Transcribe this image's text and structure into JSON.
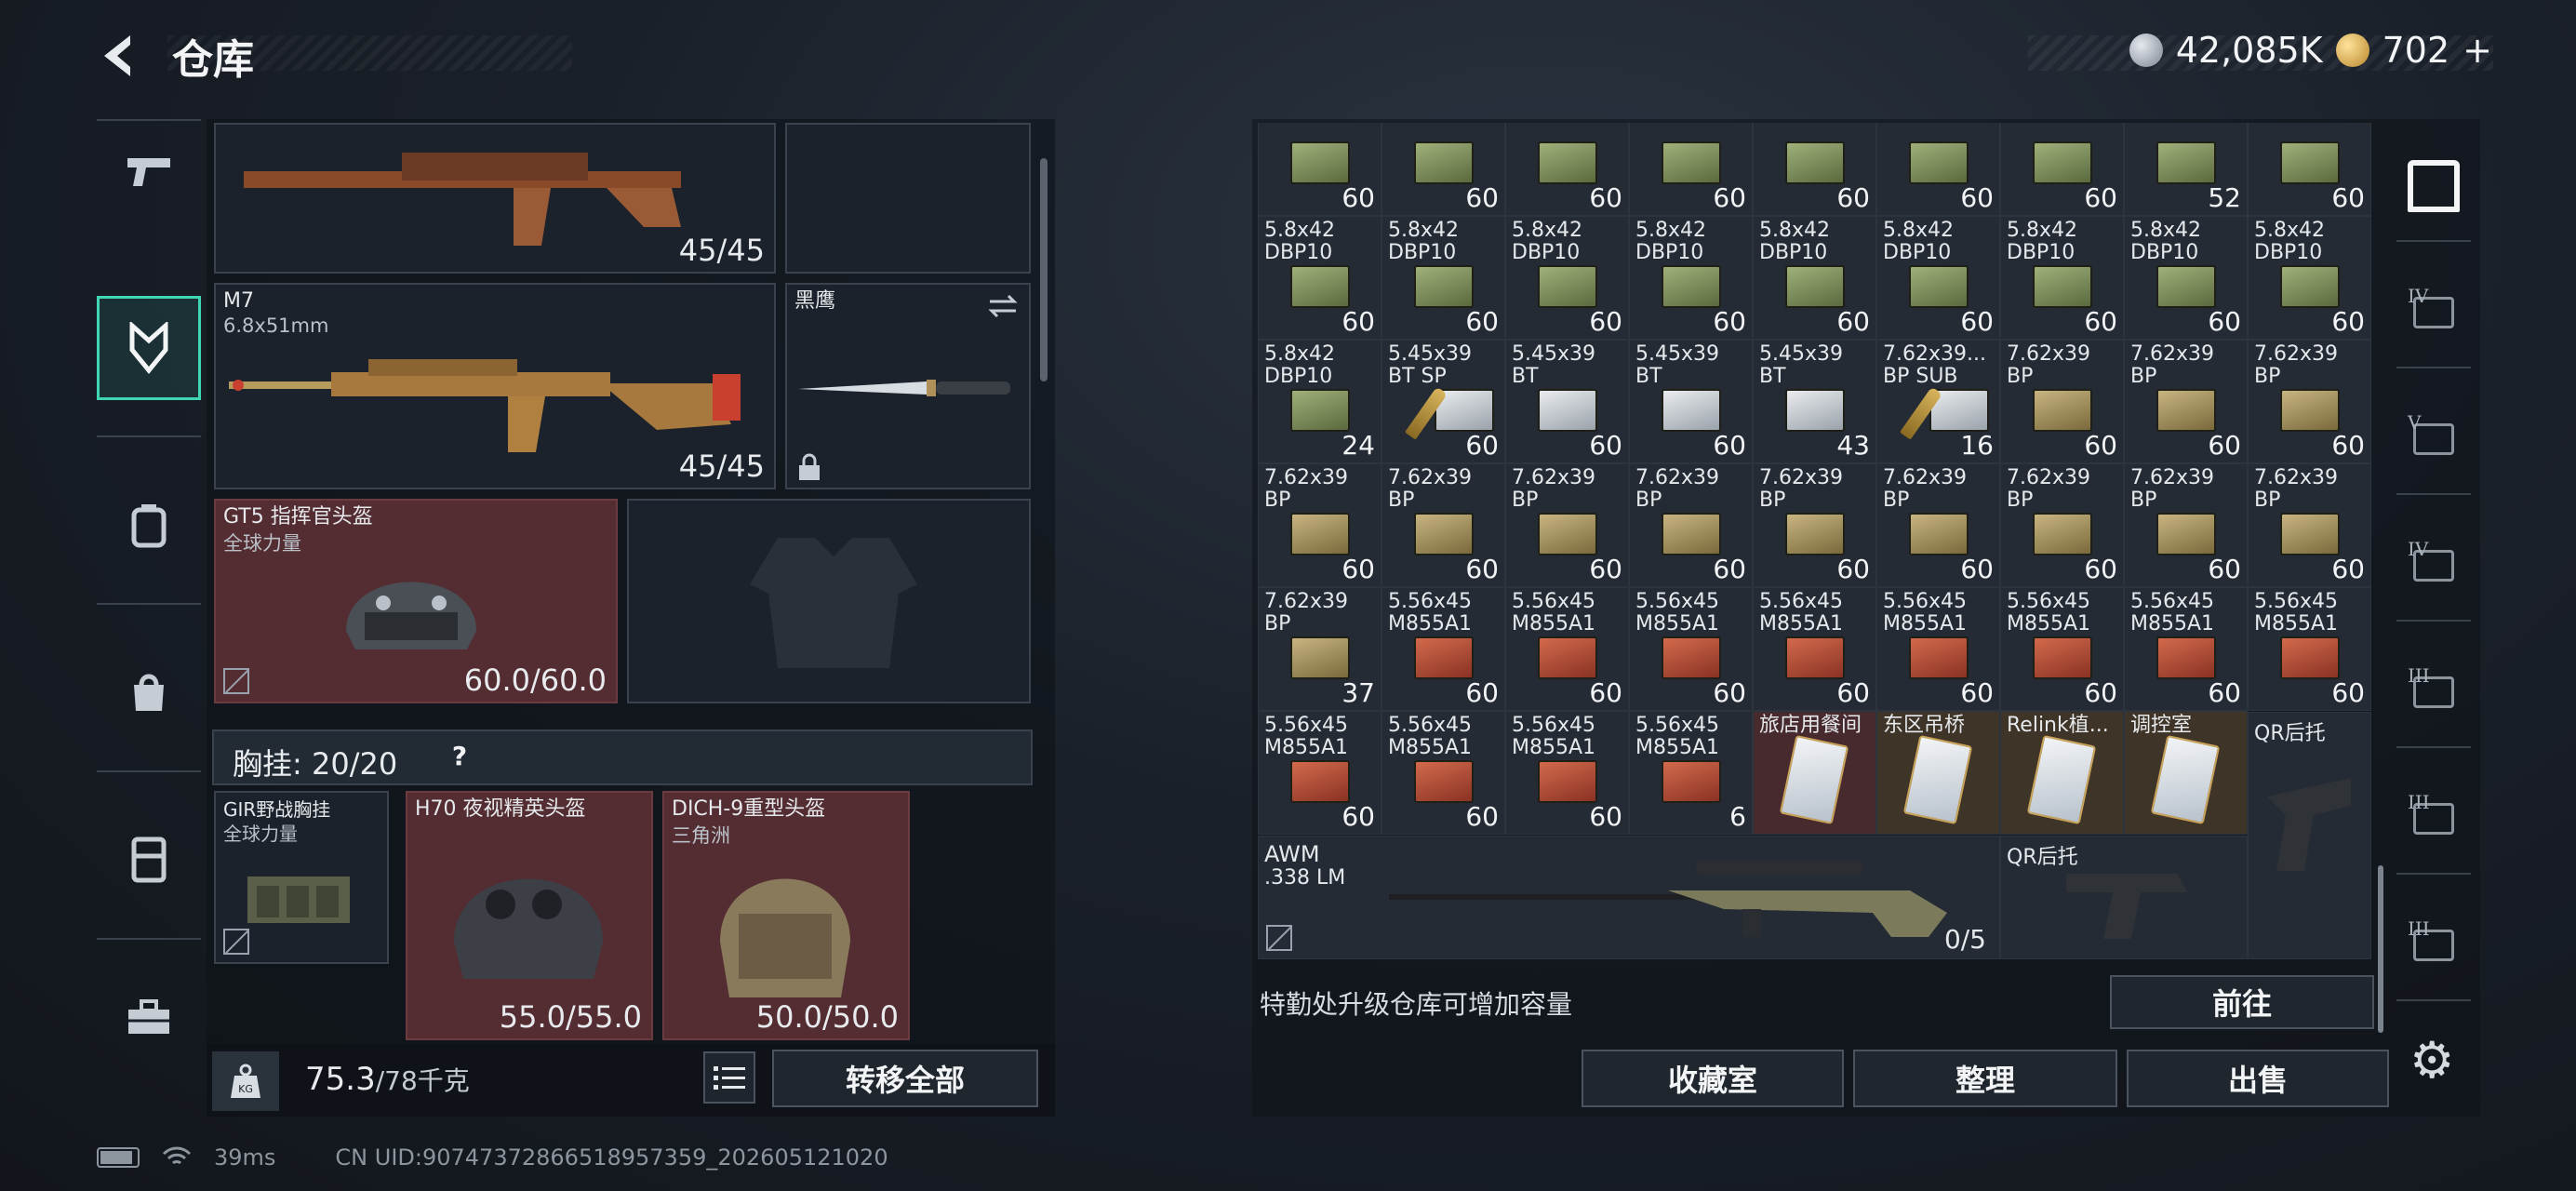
{
  "header": {
    "title": "仓库",
    "currency_silver": "42,085K",
    "currency_gold": "702",
    "add_symbol": "+"
  },
  "sidebar": {
    "items": [
      {
        "icon": "pistol-icon"
      },
      {
        "icon": "armor-emblem-icon",
        "active": true
      },
      {
        "icon": "backpack-icon"
      },
      {
        "icon": "bag-icon"
      },
      {
        "icon": "vest-icon"
      },
      {
        "icon": "toolbox-icon"
      }
    ]
  },
  "loadout": {
    "rifle_top": {
      "durability": "45/45"
    },
    "m7": {
      "name": "M7",
      "caliber": "6.8x51mm",
      "durability": "45/45"
    },
    "knife": {
      "name": "黑鹰"
    },
    "helmet": {
      "name": "GT5 指挥官头盔",
      "sub": "全球力量",
      "durability": "60.0/60.0"
    },
    "chest_label": "胸挂:",
    "chest_value": "20/20",
    "chest_help": "?",
    "rig": {
      "name": "GIR野战胸挂",
      "sub": "全球力量"
    },
    "h70": {
      "name": "H70 夜视精英头盔",
      "durability": "55.0/55.0"
    },
    "dich": {
      "name": "DICH-9重型头盔",
      "sub": "三角洲",
      "durability": "50.0/50.0"
    },
    "weight_value": "75.3",
    "weight_max": "/78千克",
    "kg_label": "KG",
    "list_icon": "list-icon",
    "transfer_all": "转移全部"
  },
  "storage": {
    "row0": [
      {
        "label": "",
        "count": "60",
        "box": "green"
      },
      {
        "label": "",
        "count": "60",
        "box": "green"
      },
      {
        "label": "",
        "count": "60",
        "box": "green"
      },
      {
        "label": "",
        "count": "60",
        "box": "green"
      },
      {
        "label": "",
        "count": "60",
        "box": "green"
      },
      {
        "label": "",
        "count": "60",
        "box": "green"
      },
      {
        "label": "",
        "count": "60",
        "box": "green"
      },
      {
        "label": "",
        "count": "52",
        "box": "green"
      },
      {
        "label": "",
        "count": "60",
        "box": "green"
      }
    ],
    "row1": [
      {
        "label": "5.8x42\nDBP10",
        "count": "60",
        "box": "green"
      },
      {
        "label": "5.8x42\nDBP10",
        "count": "60",
        "box": "green"
      },
      {
        "label": "5.8x42\nDBP10",
        "count": "60",
        "box": "green"
      },
      {
        "label": "5.8x42\nDBP10",
        "count": "60",
        "box": "green"
      },
      {
        "label": "5.8x42\nDBP10",
        "count": "60",
        "box": "green"
      },
      {
        "label": "5.8x42\nDBP10",
        "count": "60",
        "box": "green"
      },
      {
        "label": "5.8x42\nDBP10",
        "count": "60",
        "box": "green"
      },
      {
        "label": "5.8x42\nDBP10",
        "count": "60",
        "box": "green"
      },
      {
        "label": "5.8x42\nDBP10",
        "count": "60",
        "box": "green"
      }
    ],
    "row2": [
      {
        "label": "5.8x42\nDBP10",
        "count": "24",
        "box": "green"
      },
      {
        "label": "5.45x39\nBT SP",
        "count": "60",
        "box": "bullet"
      },
      {
        "label": "5.45x39\nBT",
        "count": "60",
        "box": "white"
      },
      {
        "label": "5.45x39\nBT",
        "count": "60",
        "box": "white"
      },
      {
        "label": "5.45x39\nBT",
        "count": "43",
        "box": "white"
      },
      {
        "label": "7.62x39...\nBP SUB",
        "count": "16",
        "box": "bullet"
      },
      {
        "label": "7.62x39\nBP",
        "count": "60",
        "box": "olive"
      },
      {
        "label": "7.62x39\nBP",
        "count": "60",
        "box": "olive"
      },
      {
        "label": "7.62x39\nBP",
        "count": "60",
        "box": "olive"
      }
    ],
    "row3": [
      {
        "label": "7.62x39\nBP",
        "count": "60",
        "box": "olive"
      },
      {
        "label": "7.62x39\nBP",
        "count": "60",
        "box": "olive"
      },
      {
        "label": "7.62x39\nBP",
        "count": "60",
        "box": "olive"
      },
      {
        "label": "7.62x39\nBP",
        "count": "60",
        "box": "olive"
      },
      {
        "label": "7.62x39\nBP",
        "count": "60",
        "box": "olive"
      },
      {
        "label": "7.62x39\nBP",
        "count": "60",
        "box": "olive"
      },
      {
        "label": "7.62x39\nBP",
        "count": "60",
        "box": "olive"
      },
      {
        "label": "7.62x39\nBP",
        "count": "60",
        "box": "olive"
      },
      {
        "label": "7.62x39\nBP",
        "count": "60",
        "box": "olive"
      }
    ],
    "row4": [
      {
        "label": "7.62x39\nBP",
        "count": "37",
        "box": "olive"
      },
      {
        "label": "5.56x45\nM855A1",
        "count": "60",
        "box": "red"
      },
      {
        "label": "5.56x45\nM855A1",
        "count": "60",
        "box": "red"
      },
      {
        "label": "5.56x45\nM855A1",
        "count": "60",
        "box": "red"
      },
      {
        "label": "5.56x45\nM855A1",
        "count": "60",
        "box": "red"
      },
      {
        "label": "5.56x45\nM855A1",
        "count": "60",
        "box": "red"
      },
      {
        "label": "5.56x45\nM855A1",
        "count": "60",
        "box": "red"
      },
      {
        "label": "5.56x45\nM855A1",
        "count": "60",
        "box": "red"
      },
      {
        "label": "5.56x45\nM855A1",
        "count": "60",
        "box": "red"
      }
    ],
    "row5": [
      {
        "label": "5.56x45\nM855A1",
        "count": "60",
        "box": "red"
      },
      {
        "label": "5.56x45\nM855A1",
        "count": "60",
        "box": "red"
      },
      {
        "label": "5.56x45\nM855A1",
        "count": "60",
        "box": "red"
      },
      {
        "label": "5.56x45\nM855A1",
        "count": "6",
        "box": "red"
      },
      {
        "label": "旅店用餐间",
        "count": "",
        "box": "card",
        "bg": "red"
      },
      {
        "label": "东区吊桥",
        "count": "",
        "box": "card",
        "bg": "brown"
      },
      {
        "label": "Relink植...",
        "count": "",
        "box": "card",
        "bg": "brown"
      },
      {
        "label": "调控室",
        "count": "",
        "box": "card",
        "bg": "brown"
      }
    ],
    "qr_top": "QR后托",
    "awm": {
      "name": "AWM",
      "caliber": ".338 LM",
      "ammo": "0/5"
    },
    "qr_bottom": "QR后托",
    "upgrade_hint": "特勤处升级仓库可增加容量",
    "goto": "前往",
    "collection": "收藏室",
    "organize": "整理",
    "sell": "出售"
  },
  "right_tabs": [
    {
      "icon": "storage-home-icon",
      "tier": ""
    },
    {
      "icon": "tier4-armor-icon",
      "tier": "IV"
    },
    {
      "icon": "tier5-armor-icon",
      "tier": "V"
    },
    {
      "icon": "tier4-rig-icon",
      "tier": "IV"
    },
    {
      "icon": "tier3-item-icon",
      "tier": "III"
    },
    {
      "icon": "tier3-weapon-icon",
      "tier": "III"
    },
    {
      "icon": "tier3-rifle-icon",
      "tier": "III"
    }
  ],
  "status_bar": {
    "ping": "39ms",
    "uid": "CN UID:9074737286651895735​9_202605121020"
  }
}
